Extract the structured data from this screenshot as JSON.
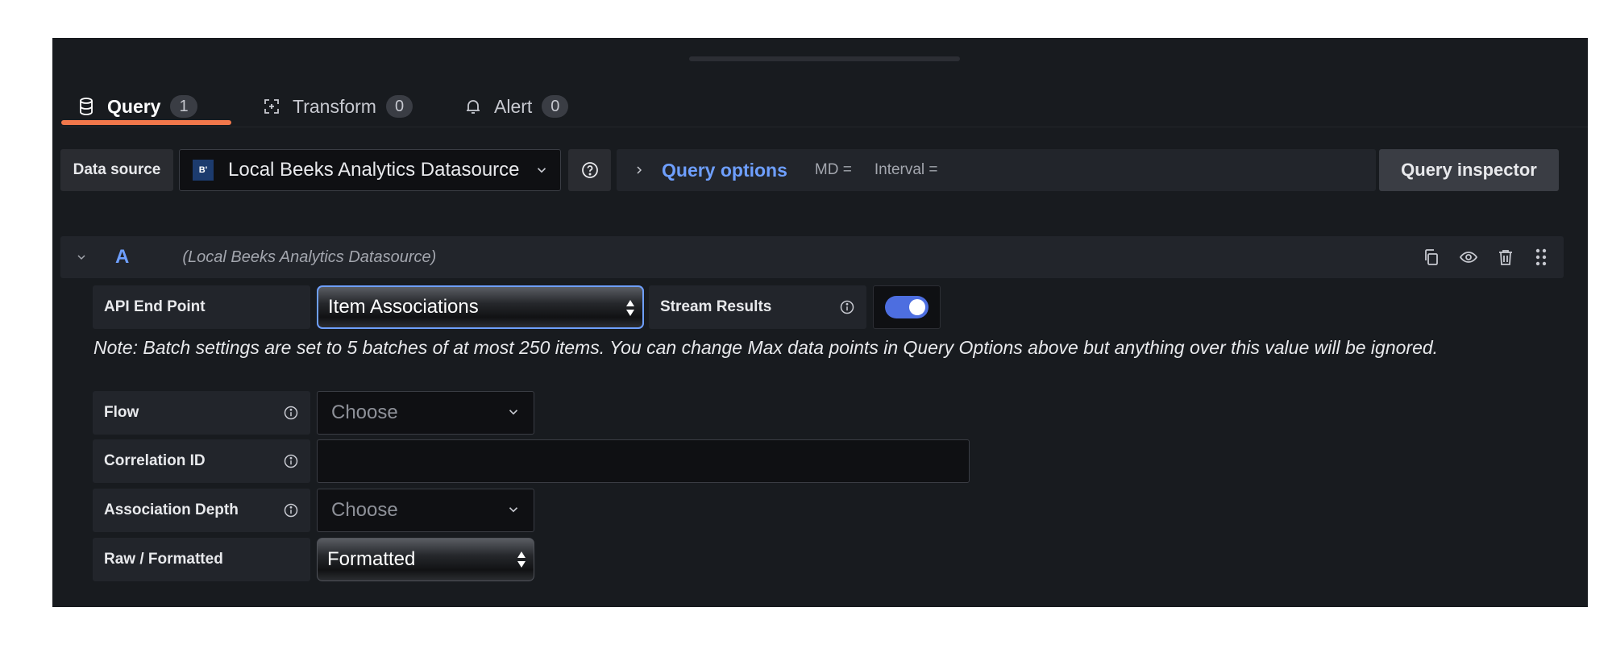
{
  "tabs": [
    {
      "label": "Query",
      "count": "1",
      "icon": "database-icon"
    },
    {
      "label": "Transform",
      "count": "0",
      "icon": "transform-icon"
    },
    {
      "label": "Alert",
      "count": "0",
      "icon": "bell-icon"
    }
  ],
  "toolbar": {
    "datasource_label": "Data source",
    "datasource_value": "Local Beeks Analytics Datasource",
    "datasource_logo_text": "B'",
    "query_options_title": "Query options",
    "md_label": "MD =",
    "interval_label": "Interval =",
    "query_inspector_label": "Query inspector"
  },
  "query": {
    "ref_id": "A",
    "datasource_name": "(Local Beeks Analytics Datasource)"
  },
  "form": {
    "api_endpoint_label": "API End Point",
    "api_endpoint_value": "Item Associations",
    "stream_results_label": "Stream Results",
    "stream_results_on": true,
    "note": "Note: Batch settings are set to 5 batches of at most 250 items. You can change Max data points in Query Options above but anything over this value will be ignored.",
    "flow_label": "Flow",
    "flow_placeholder": "Choose",
    "correlation_id_label": "Correlation ID",
    "correlation_id_value": "",
    "association_depth_label": "Association Depth",
    "association_depth_placeholder": "Choose",
    "raw_formatted_label": "Raw / Formatted",
    "raw_formatted_value": "Formatted"
  },
  "colors": {
    "accent_blue": "#6e9fff",
    "tab_underline": "#f2784b",
    "switch_on": "#4d6ee0",
    "panel_bg": "#181b1f"
  }
}
